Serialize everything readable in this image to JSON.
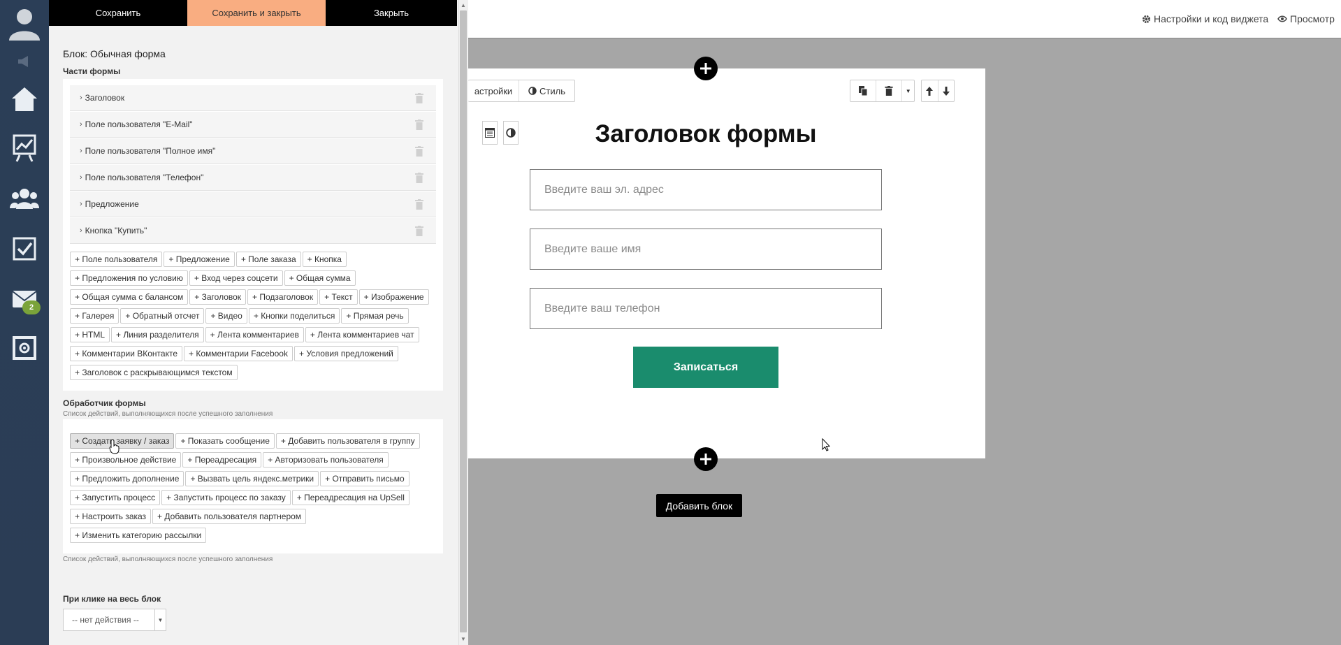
{
  "editor": {
    "top_buttons": {
      "save": "Сохранить",
      "save_close": "Сохранить и закрыть",
      "close": "Закрыть"
    },
    "block_title": "Блок: Обычная форма",
    "parts_label": "Части формы",
    "parts": [
      "Заголовок",
      "Поле пользователя \"E-Mail\"",
      "Поле пользователя \"Полное имя\"",
      "Поле пользователя \"Телефон\"",
      "Предложение",
      "Кнопка \"Купить\""
    ],
    "add_part_tags": [
      "+ Поле пользователя",
      "+ Предложение",
      "+ Поле заказа",
      "+ Кнопка",
      "+ Предложения по условию",
      "+ Вход через соцсети",
      "+ Общая сумма",
      "+ Общая сумма с балансом",
      "+ Заголовок",
      "+ Подзаголовок",
      "+ Текст",
      "+ Изображение",
      "+ Галерея",
      "+ Обратный отсчет",
      "+ Видео",
      "+ Кнопки поделиться",
      "+ Прямая речь",
      "+ HTML",
      "+ Линия разделителя",
      "+ Лента комментариев",
      "+ Лента комментариев чат",
      "+ Комментарии ВКонтакте",
      "+ Комментарии Facebook",
      "+ Условия предложений",
      "+ Заголовок с раскрывающимся текстом"
    ],
    "handler_label": "Обработчик формы",
    "handler_sub": "Список действий, выполняющихся после успешного заполнения",
    "handler_tags": [
      "+ Создать заявку / заказ",
      "+ Показать сообщение",
      "+ Добавить пользователя в группу",
      "+ Произвольное действие",
      "+ Переадресация",
      "+ Авторизовать пользователя",
      "+ Предложить дополнение",
      "+ Вызвать цель яндекс.метрики",
      "+ Отправить письмо",
      "+ Запустить процесс",
      "+ Запустить процесс по заказу",
      "+ Переадресация на UpSell",
      "+ Настроить заказ",
      "+ Добавить пользователя партнером",
      "+ Изменить категорию рассылки"
    ],
    "handler_sub_bottom": "Список действий, выполняющихся после успешного заполнения",
    "click_label": "При клике на весь блок",
    "click_select_value": "-- нет действия --"
  },
  "nav": {
    "mail_badge": "2"
  },
  "topbar": {
    "settings_link": "Настройки и код виджета",
    "preview_link": "Просмотр"
  },
  "canvas": {
    "toolbar": {
      "settings": "астройки",
      "style": "Стиль"
    },
    "form_title": "Заголовок формы",
    "inputs": {
      "email_placeholder": "Введите ваш эл. адрес",
      "name_placeholder": "Введите ваше имя",
      "phone_placeholder": "Введите ваш телефон"
    },
    "submit_label": "Записаться",
    "add_block_label": "Добавить блок"
  }
}
